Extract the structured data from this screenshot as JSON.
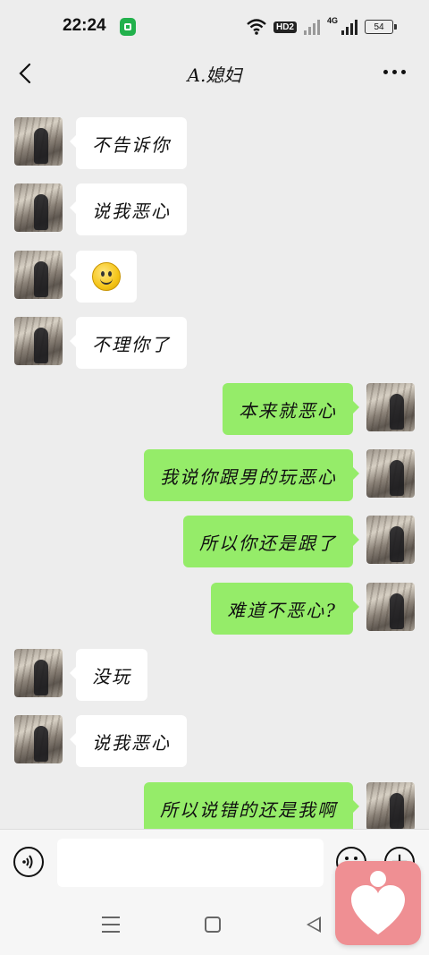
{
  "status_bar": {
    "time": "22:24",
    "hd_badge": "HD2",
    "network_label": "4G",
    "battery": "54"
  },
  "header": {
    "title": "A.媳妇"
  },
  "messages": [
    {
      "side": "left",
      "type": "text",
      "text": "不告诉你"
    },
    {
      "side": "left",
      "type": "text",
      "text": "说我恶心"
    },
    {
      "side": "left",
      "type": "emoji",
      "icon": "smiley-emoji"
    },
    {
      "side": "left",
      "type": "text",
      "text": "不理你了"
    },
    {
      "side": "right",
      "type": "text",
      "text": "本来就恶心"
    },
    {
      "side": "right",
      "type": "text",
      "text": "我说你跟男的玩恶心"
    },
    {
      "side": "right",
      "type": "text",
      "text": "所以你还是跟了"
    },
    {
      "side": "right",
      "type": "text",
      "text": "难道不恶心?"
    },
    {
      "side": "left",
      "type": "text",
      "text": "没玩"
    },
    {
      "side": "left",
      "type": "text",
      "text": "说我恶心"
    },
    {
      "side": "right",
      "type": "text",
      "text": "所以说错的还是我啊"
    }
  ],
  "input_bar": {
    "value": "",
    "placeholder": ""
  },
  "colors": {
    "outgoing_bubble": "#95ec69",
    "incoming_bubble": "#ffffff",
    "background": "#ededed",
    "floater": "#ef8f93"
  }
}
